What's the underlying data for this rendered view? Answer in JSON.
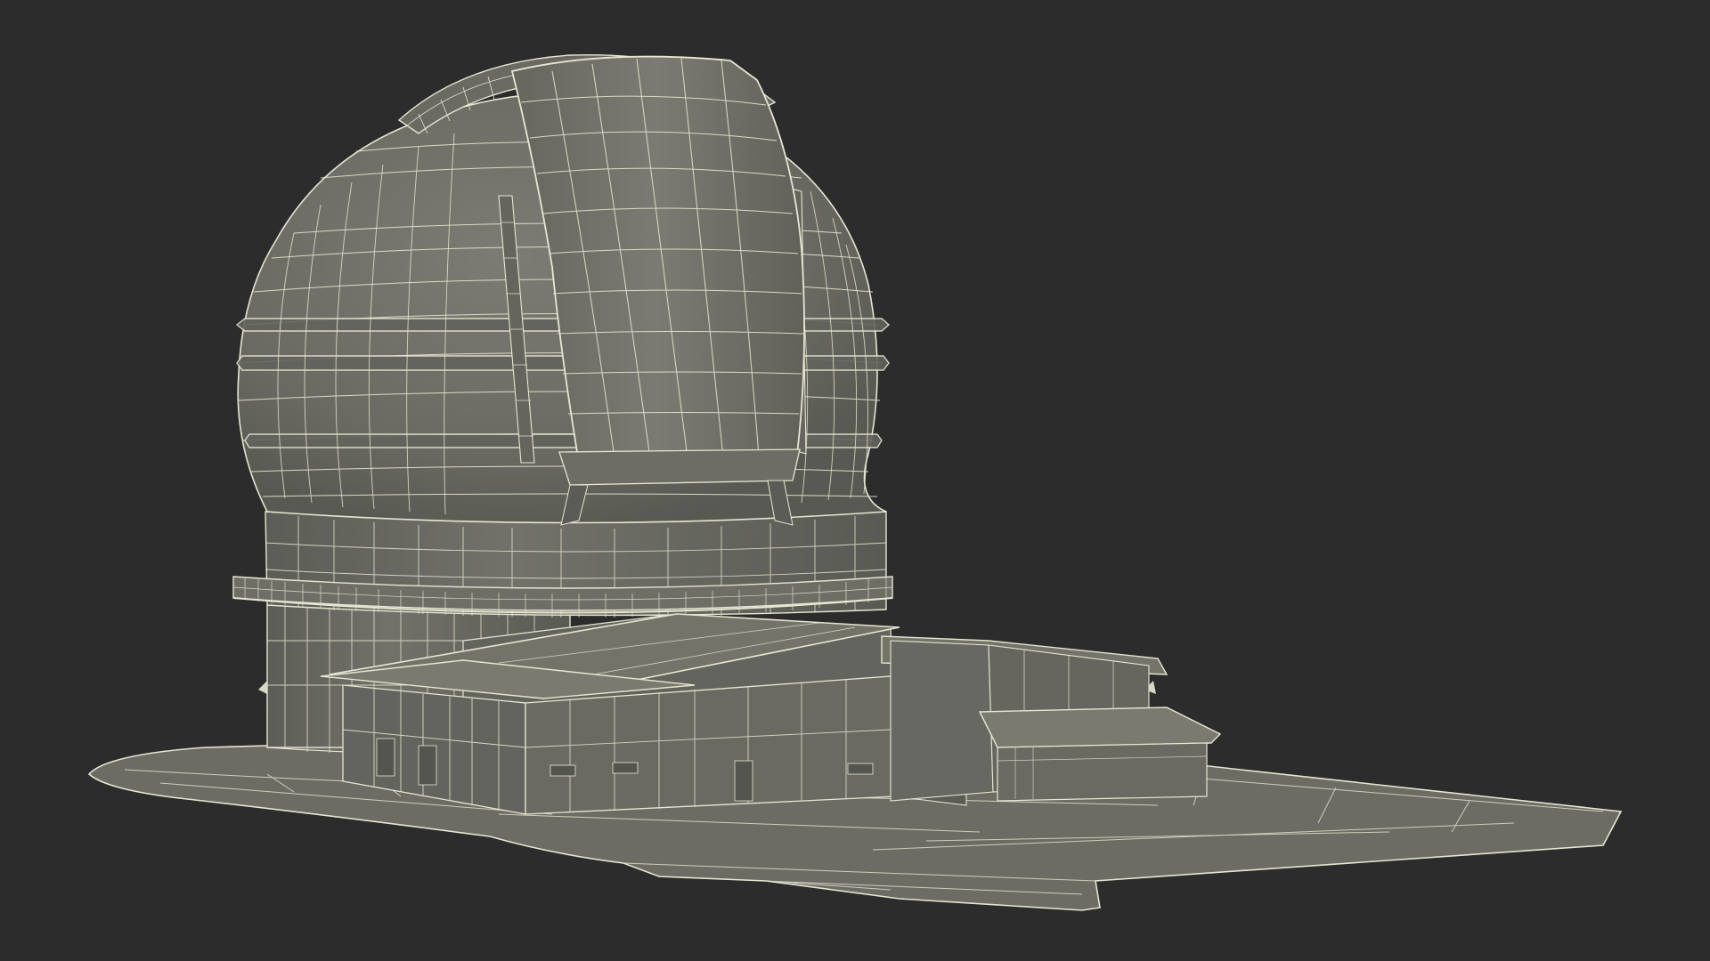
{
  "scene": {
    "subject": "observatory-dome-wireframe-render",
    "view": "3d-viewport",
    "colors": {
      "background": "#2c2c2c",
      "surface": "#6f6f68",
      "surface_dark": "#5e5e58",
      "surface_light": "#7a7a72",
      "wire": "#e6e6d2",
      "ground": "#6c6c65"
    }
  }
}
